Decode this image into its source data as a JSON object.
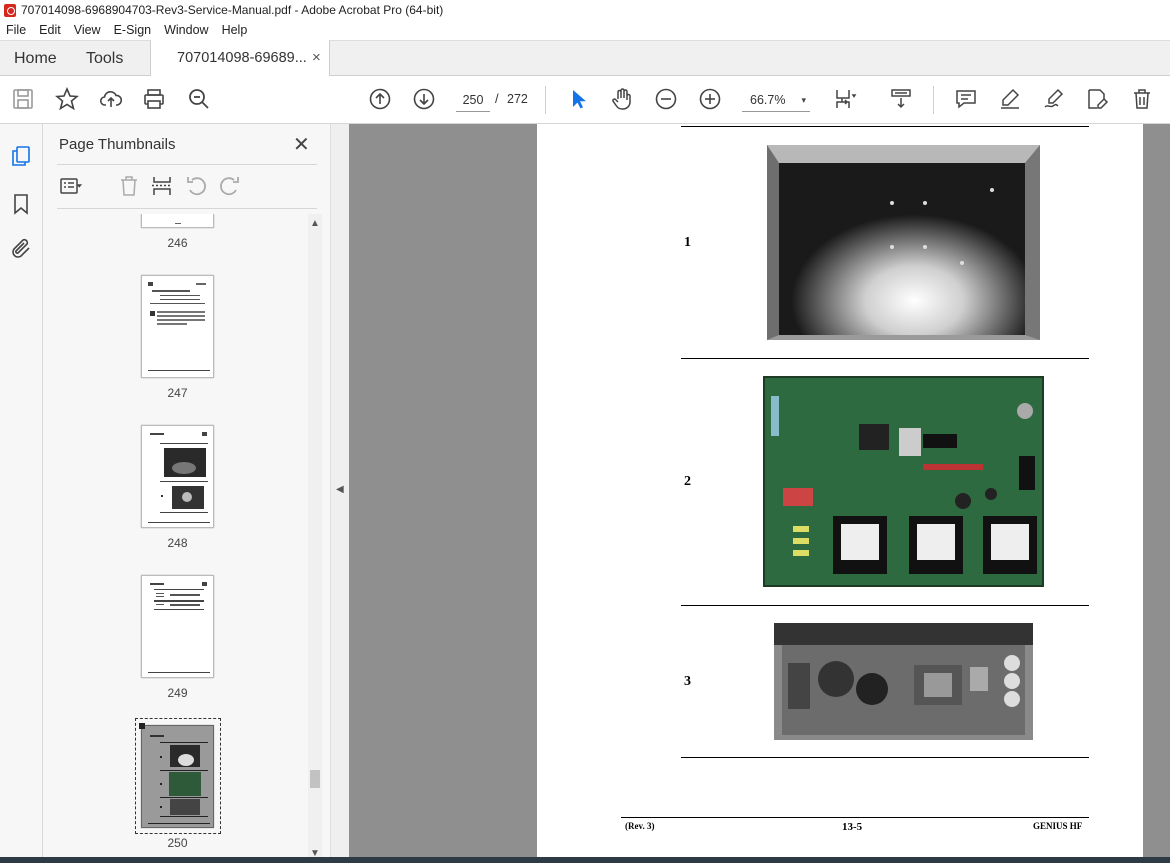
{
  "window": {
    "title": "707014098-6968904703-Rev3-Service-Manual.pdf - Adobe Acrobat Pro (64-bit)"
  },
  "menu": [
    "File",
    "Edit",
    "View",
    "E-Sign",
    "Window",
    "Help"
  ],
  "tabs": {
    "home": "Home",
    "tools": "Tools",
    "document": "707014098-69689...",
    "close": "×"
  },
  "toolbar": {
    "current_page": "250",
    "separator": "/",
    "total_pages": "272",
    "zoom": "66.7%",
    "zoom_caret": "▾"
  },
  "sidebar": {
    "panel_title": "Page Thumbnails",
    "close": "✕",
    "thumbnails": [
      {
        "label": "246"
      },
      {
        "label": "247"
      },
      {
        "label": "248"
      },
      {
        "label": "249"
      },
      {
        "label": "250",
        "selected": true
      }
    ]
  },
  "document": {
    "items": [
      {
        "number": "1"
      },
      {
        "number": "2"
      },
      {
        "number": "3"
      }
    ],
    "footer": {
      "left": "(Rev. 3)",
      "center": "13-5",
      "right": "GENIUS HF"
    }
  },
  "colors": {
    "acrobat_red": "#d7261e",
    "accent_blue": "#1473e6",
    "doc_background": "#8f8f8f"
  }
}
